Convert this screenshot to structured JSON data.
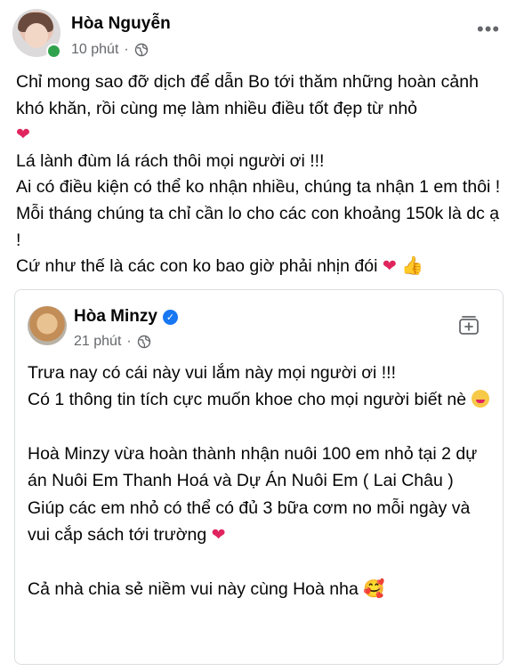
{
  "post": {
    "author": "Hòa Nguyễn",
    "time": "10 phút",
    "separator": "·",
    "more": "•••",
    "lines": [
      "Chỉ mong sao đỡ dịch để dẫn Bo tới thăm những hoàn cảnh khó khăn, rồi cùng mẹ làm nhiều điều tốt đẹp từ nhỏ",
      "Lá lành đùm lá rách thôi mọi người ơi !!!",
      "Ai có điều kiện có thể ko nhận nhiều, chúng ta nhận 1 em thôi ! Mỗi tháng chúng ta chỉ cần lo cho các con khoảng 150k là dc ạ !",
      "Cứ như thế là các con ko bao giờ phải nhịn đói"
    ],
    "heart": "❤",
    "thumb": "👍"
  },
  "shared": {
    "author": "Hòa Minzy",
    "time": "21 phút",
    "separator": "·",
    "lines": [
      "Trưa nay có cái này vui lắm này mọi người ơi !!!",
      "Có 1 thông tin tích cực muốn khoe cho mọi người biết nè",
      "Hoà Minzy vừa hoàn thành nhận nuôi 100 em nhỏ tại 2 dự án Nuôi Em Thanh Hoá và Dự Án Nuôi Em ( Lai Châu )",
      "Giúp các em nhỏ có thể có đủ 3 bữa cơm no mỗi ngày và vui cắp sách tới trường",
      "Cả nhà chia sẻ niềm vui này cùng Hoà nha"
    ],
    "heart": "❤",
    "blush": "🥰"
  },
  "colors": {
    "online": "#31a24c",
    "verified": "#1877f2",
    "heart": "#e0245e",
    "meta": "#65676b"
  }
}
